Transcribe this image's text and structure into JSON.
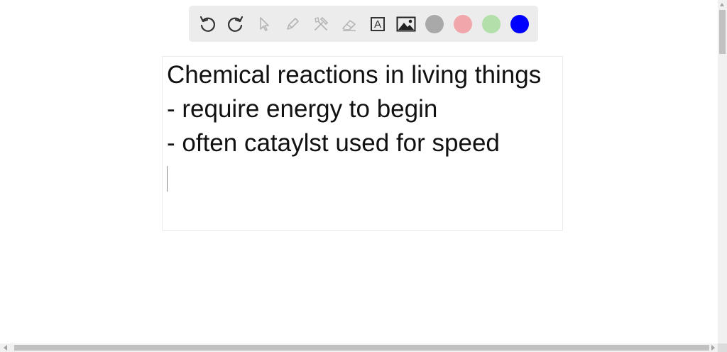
{
  "toolbar": {
    "tools": [
      {
        "name": "undo-icon",
        "enabled": true
      },
      {
        "name": "redo-icon",
        "enabled": true
      },
      {
        "name": "select-pointer-icon",
        "enabled": false
      },
      {
        "name": "pen-icon",
        "enabled": false
      },
      {
        "name": "tools-icon",
        "enabled": false
      },
      {
        "name": "eraser-icon",
        "enabled": false
      },
      {
        "name": "text-tool-icon",
        "enabled": true,
        "glyph": "A"
      },
      {
        "name": "image-icon",
        "enabled": true
      }
    ],
    "colors": {
      "gray": "#a9a9a9",
      "pink": "#f0a6ab",
      "green": "#b2dfaa",
      "blue": "#0000ff"
    }
  },
  "note": {
    "lines": [
      "Chemical reactions in living things",
      "- require energy to begin",
      "- often cataylst used for speed"
    ]
  }
}
